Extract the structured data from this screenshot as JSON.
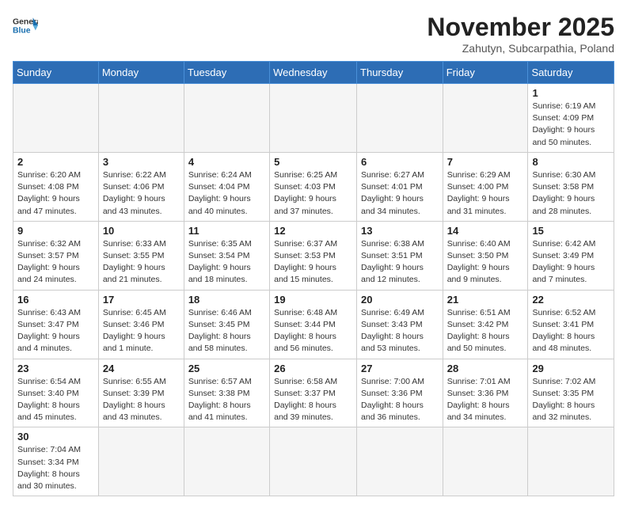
{
  "header": {
    "logo_general": "General",
    "logo_blue": "Blue",
    "month": "November 2025",
    "location": "Zahutyn, Subcarpathia, Poland"
  },
  "weekdays": [
    "Sunday",
    "Monday",
    "Tuesday",
    "Wednesday",
    "Thursday",
    "Friday",
    "Saturday"
  ],
  "weeks": [
    [
      {
        "day": "",
        "info": ""
      },
      {
        "day": "",
        "info": ""
      },
      {
        "day": "",
        "info": ""
      },
      {
        "day": "",
        "info": ""
      },
      {
        "day": "",
        "info": ""
      },
      {
        "day": "",
        "info": ""
      },
      {
        "day": "1",
        "info": "Sunrise: 6:19 AM\nSunset: 4:09 PM\nDaylight: 9 hours\nand 50 minutes."
      }
    ],
    [
      {
        "day": "2",
        "info": "Sunrise: 6:20 AM\nSunset: 4:08 PM\nDaylight: 9 hours\nand 47 minutes."
      },
      {
        "day": "3",
        "info": "Sunrise: 6:22 AM\nSunset: 4:06 PM\nDaylight: 9 hours\nand 43 minutes."
      },
      {
        "day": "4",
        "info": "Sunrise: 6:24 AM\nSunset: 4:04 PM\nDaylight: 9 hours\nand 40 minutes."
      },
      {
        "day": "5",
        "info": "Sunrise: 6:25 AM\nSunset: 4:03 PM\nDaylight: 9 hours\nand 37 minutes."
      },
      {
        "day": "6",
        "info": "Sunrise: 6:27 AM\nSunset: 4:01 PM\nDaylight: 9 hours\nand 34 minutes."
      },
      {
        "day": "7",
        "info": "Sunrise: 6:29 AM\nSunset: 4:00 PM\nDaylight: 9 hours\nand 31 minutes."
      },
      {
        "day": "8",
        "info": "Sunrise: 6:30 AM\nSunset: 3:58 PM\nDaylight: 9 hours\nand 28 minutes."
      }
    ],
    [
      {
        "day": "9",
        "info": "Sunrise: 6:32 AM\nSunset: 3:57 PM\nDaylight: 9 hours\nand 24 minutes."
      },
      {
        "day": "10",
        "info": "Sunrise: 6:33 AM\nSunset: 3:55 PM\nDaylight: 9 hours\nand 21 minutes."
      },
      {
        "day": "11",
        "info": "Sunrise: 6:35 AM\nSunset: 3:54 PM\nDaylight: 9 hours\nand 18 minutes."
      },
      {
        "day": "12",
        "info": "Sunrise: 6:37 AM\nSunset: 3:53 PM\nDaylight: 9 hours\nand 15 minutes."
      },
      {
        "day": "13",
        "info": "Sunrise: 6:38 AM\nSunset: 3:51 PM\nDaylight: 9 hours\nand 12 minutes."
      },
      {
        "day": "14",
        "info": "Sunrise: 6:40 AM\nSunset: 3:50 PM\nDaylight: 9 hours\nand 9 minutes."
      },
      {
        "day": "15",
        "info": "Sunrise: 6:42 AM\nSunset: 3:49 PM\nDaylight: 9 hours\nand 7 minutes."
      }
    ],
    [
      {
        "day": "16",
        "info": "Sunrise: 6:43 AM\nSunset: 3:47 PM\nDaylight: 9 hours\nand 4 minutes."
      },
      {
        "day": "17",
        "info": "Sunrise: 6:45 AM\nSunset: 3:46 PM\nDaylight: 9 hours\nand 1 minute."
      },
      {
        "day": "18",
        "info": "Sunrise: 6:46 AM\nSunset: 3:45 PM\nDaylight: 8 hours\nand 58 minutes."
      },
      {
        "day": "19",
        "info": "Sunrise: 6:48 AM\nSunset: 3:44 PM\nDaylight: 8 hours\nand 56 minutes."
      },
      {
        "day": "20",
        "info": "Sunrise: 6:49 AM\nSunset: 3:43 PM\nDaylight: 8 hours\nand 53 minutes."
      },
      {
        "day": "21",
        "info": "Sunrise: 6:51 AM\nSunset: 3:42 PM\nDaylight: 8 hours\nand 50 minutes."
      },
      {
        "day": "22",
        "info": "Sunrise: 6:52 AM\nSunset: 3:41 PM\nDaylight: 8 hours\nand 48 minutes."
      }
    ],
    [
      {
        "day": "23",
        "info": "Sunrise: 6:54 AM\nSunset: 3:40 PM\nDaylight: 8 hours\nand 45 minutes."
      },
      {
        "day": "24",
        "info": "Sunrise: 6:55 AM\nSunset: 3:39 PM\nDaylight: 8 hours\nand 43 minutes."
      },
      {
        "day": "25",
        "info": "Sunrise: 6:57 AM\nSunset: 3:38 PM\nDaylight: 8 hours\nand 41 minutes."
      },
      {
        "day": "26",
        "info": "Sunrise: 6:58 AM\nSunset: 3:37 PM\nDaylight: 8 hours\nand 39 minutes."
      },
      {
        "day": "27",
        "info": "Sunrise: 7:00 AM\nSunset: 3:36 PM\nDaylight: 8 hours\nand 36 minutes."
      },
      {
        "day": "28",
        "info": "Sunrise: 7:01 AM\nSunset: 3:36 PM\nDaylight: 8 hours\nand 34 minutes."
      },
      {
        "day": "29",
        "info": "Sunrise: 7:02 AM\nSunset: 3:35 PM\nDaylight: 8 hours\nand 32 minutes."
      }
    ],
    [
      {
        "day": "30",
        "info": "Sunrise: 7:04 AM\nSunset: 3:34 PM\nDaylight: 8 hours\nand 30 minutes."
      },
      {
        "day": "",
        "info": ""
      },
      {
        "day": "",
        "info": ""
      },
      {
        "day": "",
        "info": ""
      },
      {
        "day": "",
        "info": ""
      },
      {
        "day": "",
        "info": ""
      },
      {
        "day": "",
        "info": ""
      }
    ]
  ]
}
